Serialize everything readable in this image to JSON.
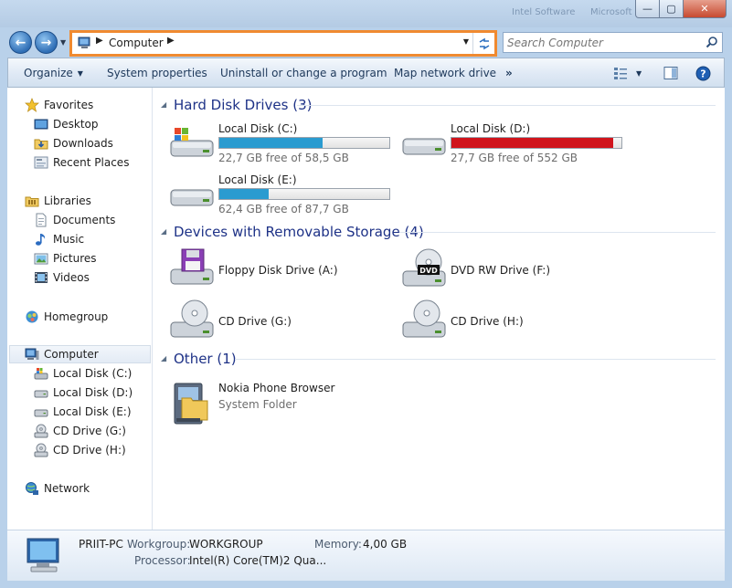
{
  "titlebar": {
    "ghost_text_1": "Intel Software",
    "ghost_text_2": "Microsoft"
  },
  "window_controls": {
    "minimize": "—",
    "maximize": "▢",
    "close": "✕"
  },
  "navigation": {
    "back": "←",
    "forward": "→"
  },
  "address_bar": {
    "path": "Computer",
    "refresh_icon": "refresh-icon"
  },
  "search": {
    "placeholder": "Search Computer"
  },
  "command_bar": {
    "organize": "Organize",
    "system_properties": "System properties",
    "uninstall": "Uninstall or change a program",
    "map_drive": "Map network drive",
    "more": "»"
  },
  "nav_pane": {
    "favorites": "Favorites",
    "desktop": "Desktop",
    "downloads": "Downloads",
    "recent_places": "Recent Places",
    "libraries": "Libraries",
    "documents": "Documents",
    "music": "Music",
    "pictures": "Pictures",
    "videos": "Videos",
    "homegroup": "Homegroup",
    "computer": "Computer",
    "disk_c": "Local Disk (C:)",
    "disk_d": "Local Disk (D:)",
    "disk_e": "Local Disk (E:)",
    "cd_g": "CD Drive (G:)",
    "cd_h": "CD Drive (H:)",
    "network": "Network"
  },
  "groups": {
    "hard_disks": "Hard Disk Drives (3)",
    "removable": "Devices with Removable Storage (4)",
    "other": "Other (1)"
  },
  "drives": {
    "c": {
      "name": "Local Disk (C:)",
      "free": "22,7 GB free of 58,5 GB",
      "used_fraction": 0.61,
      "bar_color": "#2a9bd0"
    },
    "d": {
      "name": "Local Disk (D:)",
      "free": "27,7 GB free of 552 GB",
      "used_fraction": 0.95,
      "bar_color": "#d0141c"
    },
    "e": {
      "name": "Local Disk (E:)",
      "free": "62,4 GB free of 87,7 GB",
      "used_fraction": 0.29,
      "bar_color": "#2a9bd0"
    }
  },
  "removable": {
    "floppy": "Floppy Disk Drive (A:)",
    "dvd": "DVD RW Drive (F:)",
    "dvd_badge": "DVD",
    "cd_g": "CD Drive (G:)",
    "cd_h": "CD Drive (H:)"
  },
  "other": {
    "name": "Nokia Phone Browser",
    "type": "System Folder"
  },
  "details": {
    "computer_name": "PRIIT-PC",
    "workgroup_label": "Workgroup:",
    "workgroup_value": "WORKGROUP",
    "memory_label": "Memory:",
    "memory_value": "4,00 GB",
    "processor_label": "Processor:",
    "processor_value": "Intel(R) Core(TM)2 Qua..."
  }
}
